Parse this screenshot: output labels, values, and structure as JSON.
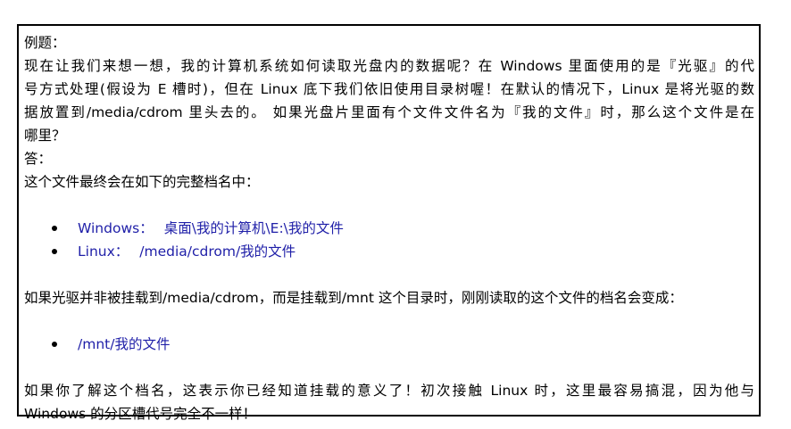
{
  "example_label": "例题：",
  "question": {
    "line1": "现在让我们来想一想，我的计算机系统如何读取光盘内的数据呢？在 Windows 里面使用的是『光驱』的代",
    "line2": "号方式处理(假设为 E 槽时)，但在 Linux 底下我们依旧使用目录树喔！在默认的情况下，Linux 是将光驱的数",
    "line3": "据放置到/media/cdrom 里头去的。 如果光盘片里面有个文件文件名为『我的文件』时，那么这个文件是在",
    "line4": "哪里？"
  },
  "answer_label": "答：",
  "answer_intro": "这个文件最终会在如下的完整档名中：",
  "paths_list": [
    {
      "os": "Windows：",
      "path": "桌面\\我的计算机\\E:\\我的文件"
    },
    {
      "os": "Linux：",
      "path": "/media/cdrom/我的文件"
    }
  ],
  "mount_change": "如果光驱并非被挂载到/media/cdrom，而是挂载到/mnt 这个目录时，刚刚读取的这个文件的档名会变成：",
  "mnt_path": "/mnt/我的文件",
  "conclusion": {
    "line1": "如果你了解这个档名，这表示你已经知道挂载的意义了！初次接触 Linux 时，这里最容易搞混，因为他与",
    "line2": "Windows 的分区槽代号完全不一样！"
  },
  "colors": {
    "text": "#000000",
    "list_text": "#1f1fa8",
    "border": "#000000"
  }
}
